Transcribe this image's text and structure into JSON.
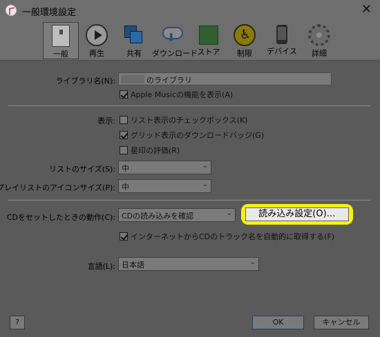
{
  "window": {
    "title": "一般環境設定",
    "close_icon": "close-icon",
    "app_icon": "itunes-icon"
  },
  "toolbar": {
    "items": [
      {
        "label": "一般",
        "icon": "general-icon",
        "selected": true
      },
      {
        "label": "再生",
        "icon": "play-icon",
        "selected": false
      },
      {
        "label": "共有",
        "icon": "share-icon",
        "selected": false
      },
      {
        "label": "ダウンロード",
        "icon": "download-icon",
        "selected": false
      },
      {
        "label": "ストア",
        "icon": "store-icon",
        "selected": false
      },
      {
        "label": "制限",
        "icon": "restrictions-icon",
        "selected": false
      },
      {
        "label": "デバイス",
        "icon": "device-icon",
        "selected": false
      },
      {
        "label": "詳細",
        "icon": "advanced-gear-icon",
        "selected": false
      }
    ]
  },
  "library": {
    "name_label": "ライブラリ名(N):",
    "name_value": "のライブラリ",
    "apple_music_checkbox": {
      "label": "Apple Musicの機能を表示(A)",
      "checked": true
    }
  },
  "display": {
    "label": "表示:",
    "list_checkbox": {
      "label": "リスト表示のチェックボックス(K)",
      "checked": false
    },
    "grid_badge_checkbox": {
      "label": "グリッド表示のダウンロードバッジ(G)",
      "checked": true
    },
    "star_rating_checkbox": {
      "label": "星印の評価(R)",
      "checked": false
    },
    "list_size_label": "リストのサイズ(S):",
    "list_size_value": "中",
    "playlist_icon_size_label": "プレイリストのアイコンサイズ(P):",
    "playlist_icon_size_value": "中"
  },
  "cd": {
    "insert_action_label": "CDをセットしたときの動作(C):",
    "insert_action_value": "CDの読み込みを確認",
    "import_settings_button": "読み込み設定(O)…",
    "highlight_color": "#f7f400",
    "track_names_checkbox": {
      "label": "インターネットからCDのトラック名を自動的に取得する(F)",
      "checked": true
    }
  },
  "language": {
    "label": "言語(L):",
    "value": "日本語"
  },
  "footer": {
    "help_label": "?",
    "ok_label": "OK",
    "cancel_label": "キャンセル"
  }
}
